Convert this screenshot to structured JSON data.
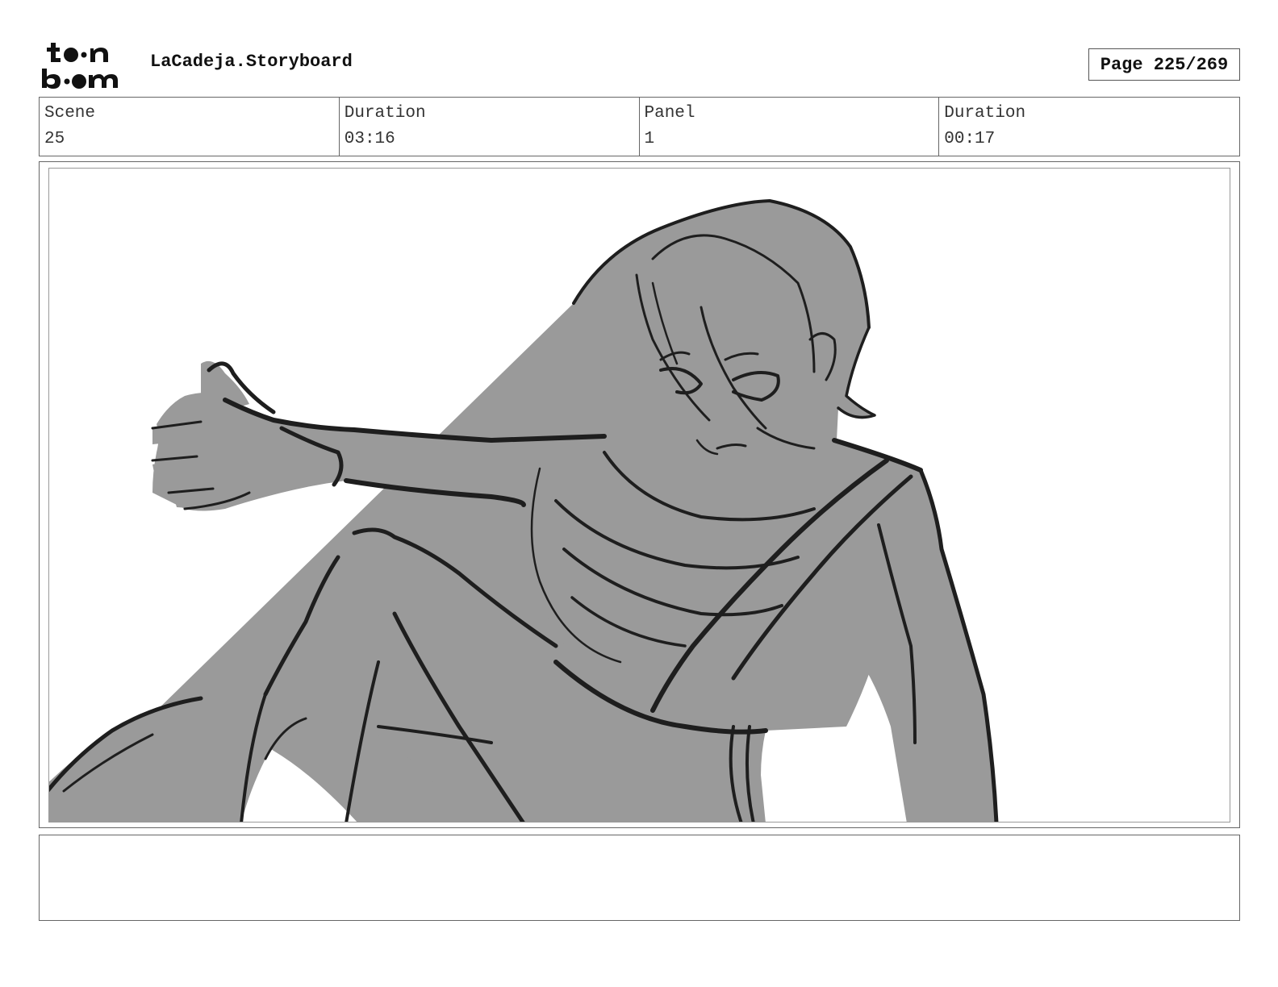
{
  "header": {
    "logo_text": "toon boom",
    "project_title": "LaCadeja.Storyboard",
    "page_label": "Page 225/269"
  },
  "info": {
    "scene_label": "Scene",
    "scene_value": "25",
    "scene_duration_label": "Duration",
    "scene_duration_value": "03:16",
    "panel_label": "Panel",
    "panel_value": "1",
    "panel_duration_label": "Duration",
    "panel_duration_value": "00:17"
  },
  "panel": {
    "fill_color": "#9a9a9a",
    "line_color": "#1e1e1e"
  },
  "notes": {
    "text": ""
  }
}
